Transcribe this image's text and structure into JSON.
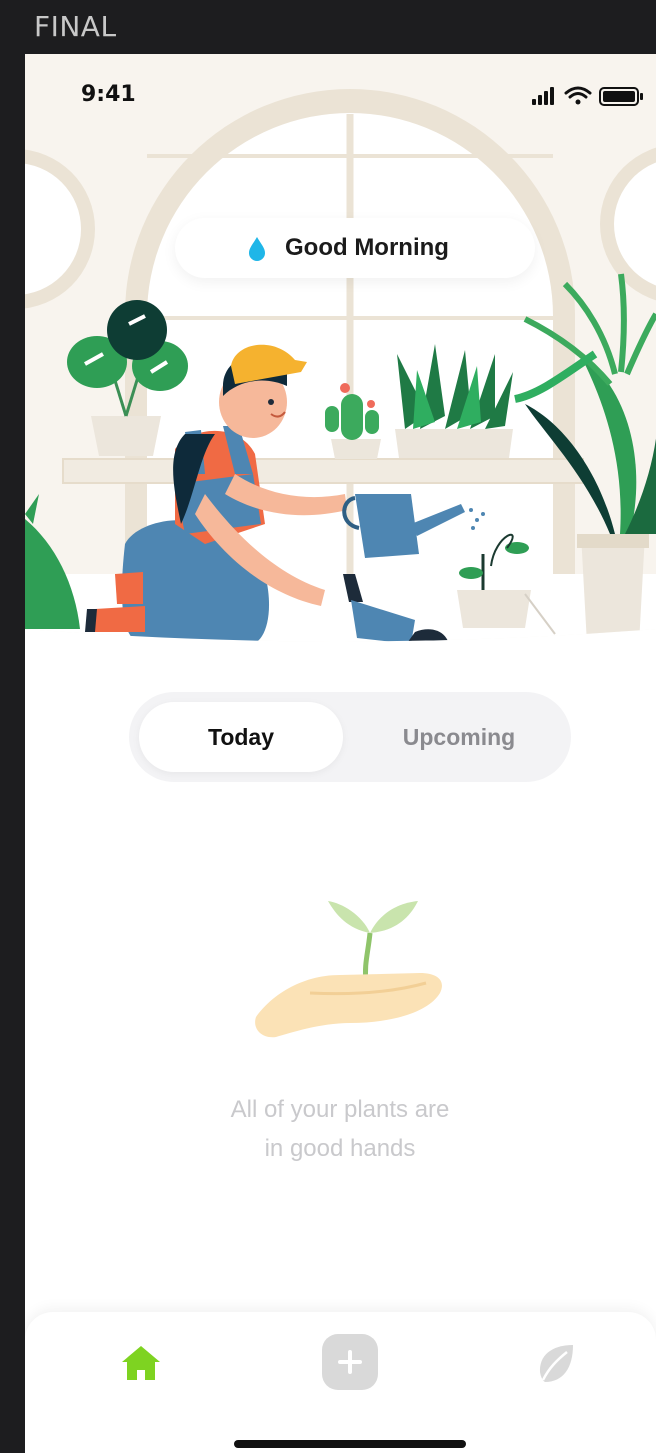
{
  "frame_label": "FINAL",
  "status_bar": {
    "time": "9:41",
    "icons": [
      "signal-icon",
      "wifi-icon",
      "battery-icon"
    ]
  },
  "greeting": {
    "icon": "water-drop-icon",
    "text": "Good Morning"
  },
  "segmented_control": {
    "options": [
      {
        "label": "Today",
        "selected": true
      },
      {
        "label": "Upcoming",
        "selected": false
      }
    ]
  },
  "empty_state": {
    "illustration": "seedling-in-hand",
    "line1": "All of your plants are",
    "line2": "in good hands"
  },
  "tab_bar": {
    "items": [
      {
        "icon": "home-icon",
        "active": true
      },
      {
        "icon": "plus-icon",
        "active": false
      },
      {
        "icon": "leaf-icon",
        "active": false
      }
    ]
  },
  "colors": {
    "accent_green": "#7ed321",
    "water_blue": "#1fb6e8",
    "muted_text": "#c9c9cc",
    "inactive_icon": "#d9d9d9"
  }
}
